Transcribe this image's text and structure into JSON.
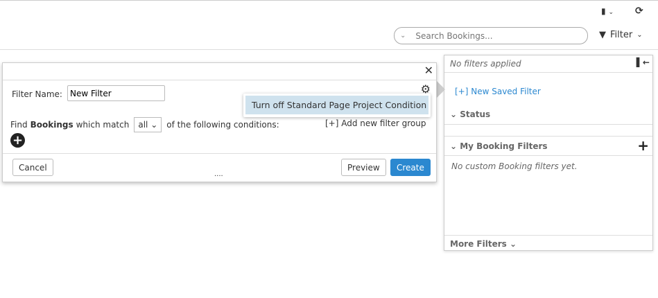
{
  "toolbar": {
    "search_placeholder": "Search Bookings...",
    "filter_label": "Filter"
  },
  "panel": {
    "status_text": "No filters applied",
    "new_saved_filter": "[+] New Saved Filter",
    "status_section": "Status",
    "my_filters_section": "My Booking Filters",
    "no_custom": "No custom Booking filters yet.",
    "more_filters": "More Filters"
  },
  "dialog": {
    "filter_name_label": "Filter Name:",
    "filter_name_value": "New Filter",
    "find_prefix": "Find",
    "entity": "Bookings",
    "match_text": "which match",
    "match_value": "all",
    "suffix": "of the following conditions:",
    "add_group": "[+] Add new filter group",
    "cancel": "Cancel",
    "preview": "Preview",
    "create": "Create",
    "resize_handle": "....",
    "menu_item": "Turn off Standard Page Project Condition"
  },
  "colors": {
    "accent": "#2b88d0",
    "link": "#2b88d0"
  }
}
